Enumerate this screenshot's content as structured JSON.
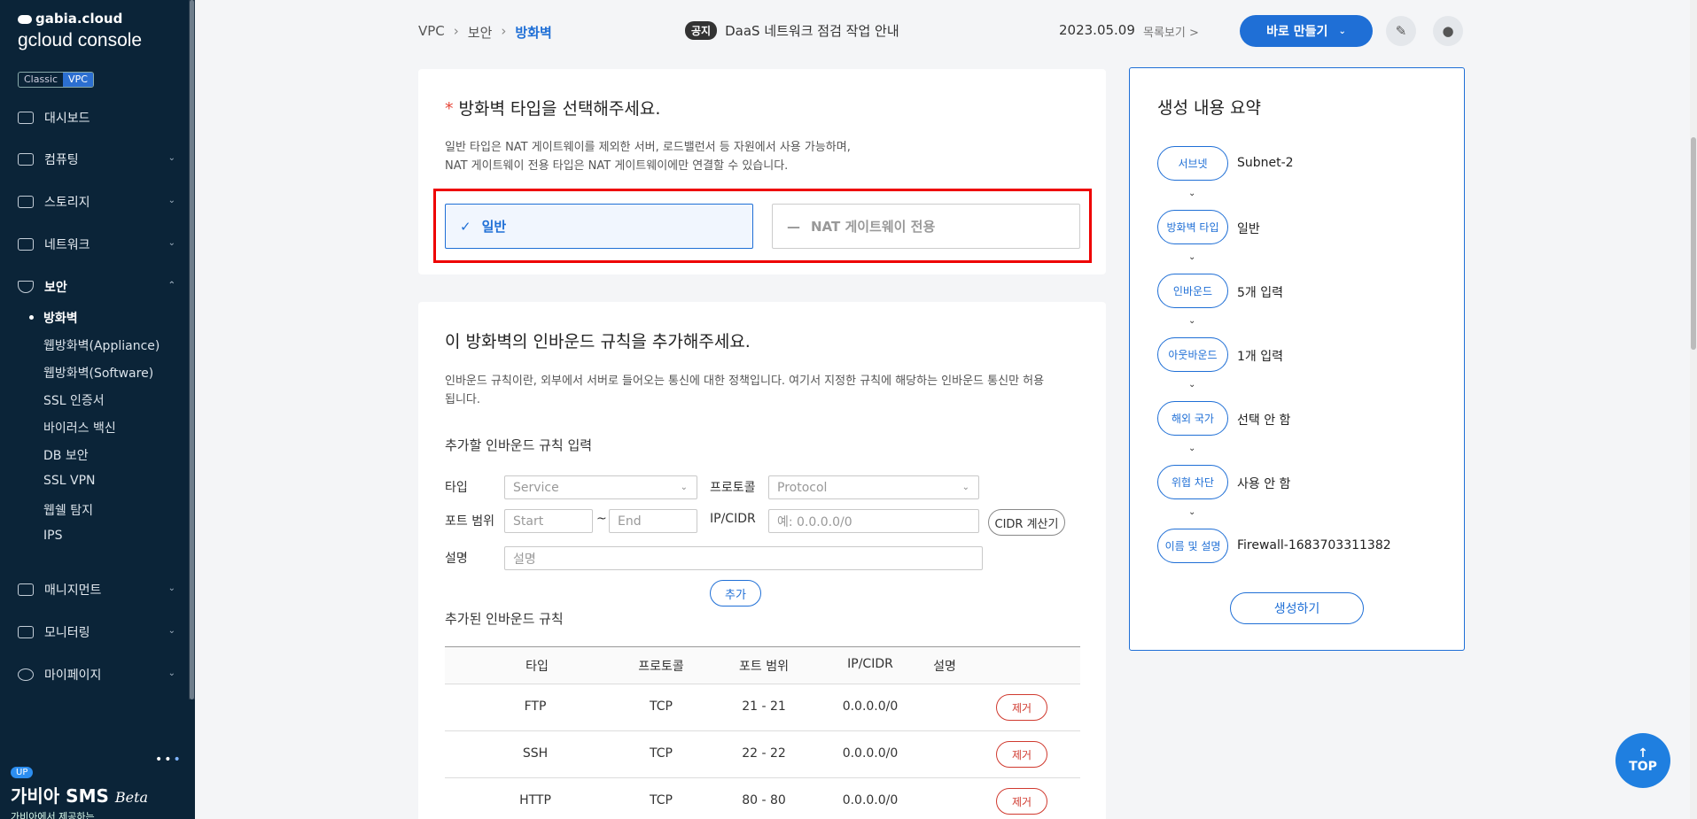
{
  "sidebar": {
    "brand_top": "gabia.cloud",
    "brand_main": "gcloud console",
    "env_classic": "Classic",
    "env_vpc": "VPC",
    "menu": [
      {
        "label": "대시보드"
      },
      {
        "label": "컴퓨팅"
      },
      {
        "label": "스토리지"
      },
      {
        "label": "네트워크"
      },
      {
        "label": "보안"
      },
      {
        "label": "매니지먼트"
      },
      {
        "label": "모니터링"
      },
      {
        "label": "마이페이지"
      }
    ],
    "security_sub": [
      "방화벽",
      "웹방화벽(Appliance)",
      "웹방화벽(Software)",
      "SSL 인증서",
      "바이러스 백신",
      "DB 보안",
      "SSL VPN",
      "웹쉘 탐지",
      "IPS"
    ],
    "up_badge": "UP",
    "sms_title": "가비아 SMS",
    "sms_beta": "Beta",
    "sms_sub": "가비아에서 제공하는"
  },
  "header": {
    "breadcrumb": [
      "VPC",
      "보안",
      "방화벽"
    ],
    "notice_tag": "공지",
    "notice_text": "DaaS 네트워크 점검 작업 안내",
    "date": "2023.05.09",
    "list_link": "목록보기 >",
    "make_button": "바로 만들기"
  },
  "type_section": {
    "title": "방화벽 타입을 선택해주세요.",
    "desc1": "일반 타입은 NAT 게이트웨이를 제외한 서버, 로드밸런서 등 자원에서 사용 가능하며,",
    "desc2": "NAT 게이트웨이 전용 타입은 NAT 게이트웨이에만 연결할 수 있습니다.",
    "option_general": "일반",
    "option_nat": "NAT 게이트웨이 전용"
  },
  "inbound": {
    "title": "이 방화벽의 인바운드 규칙을 추가해주세요.",
    "desc": "인바운드 규칙이란, 외부에서 서버로 들어오는 통신에 대한 정책입니다. 여기서 지정한 규칙에 해당하는 인바운드 통신만 허용됩니다.",
    "desc1": "인바운드 규칙이란, 외부에서 서버로 들어오는 통신에 대한 정책입니다. 여기서 지정한 규칙에 해당하는 인바운드 통신만 허용",
    "desc2": "됩니다.",
    "input_heading": "추가할 인바운드 규칙 입력",
    "type_label": "타입",
    "type_placeholder": "Service",
    "protocol_label": "프로토콜",
    "protocol_placeholder": "Protocol",
    "port_label": "포트 범위",
    "port_start": "Start",
    "port_tilde": "~",
    "port_end": "End",
    "ip_label": "IP/CIDR",
    "ip_placeholder": "예: 0.0.0.0/0",
    "cidr_button": "CIDR 계산기",
    "desc_label": "설명",
    "desc_placeholder": "설명",
    "add_button": "추가",
    "added_heading": "추가된 인바운드 규칙",
    "columns": [
      "타입",
      "프로토콜",
      "포트 범위",
      "IP/CIDR",
      "설명"
    ],
    "rows": [
      {
        "type": "FTP",
        "protocol": "TCP",
        "port": "21 - 21",
        "ip": "0.0.0.0/0",
        "remove": "제거"
      },
      {
        "type": "SSH",
        "protocol": "TCP",
        "port": "22 - 22",
        "ip": "0.0.0.0/0",
        "remove": "제거"
      },
      {
        "type": "HTTP",
        "protocol": "TCP",
        "port": "80 - 80",
        "ip": "0.0.0.0/0",
        "remove": "제거"
      }
    ]
  },
  "summary": {
    "title": "생성 내용 요약",
    "steps": [
      {
        "label": "서브넷",
        "value": "Subnet-2"
      },
      {
        "label": "방화벽 타입",
        "value": "일반"
      },
      {
        "label": "인바운드",
        "value": "5개 입력"
      },
      {
        "label": "아웃바운드",
        "value": "1개 입력"
      },
      {
        "label": "해외 국가",
        "value": "선택 안 함"
      },
      {
        "label": "위협 차단",
        "value": "사용 안 함"
      },
      {
        "label": "이름 및 설명",
        "value": "Firewall-1683703311382"
      }
    ],
    "create_button": "생성하기"
  },
  "top_button": "TOP",
  "colors": {
    "accent": "#1f6fd6",
    "sidebar": "#0b2438",
    "highlight": "#e00000"
  }
}
